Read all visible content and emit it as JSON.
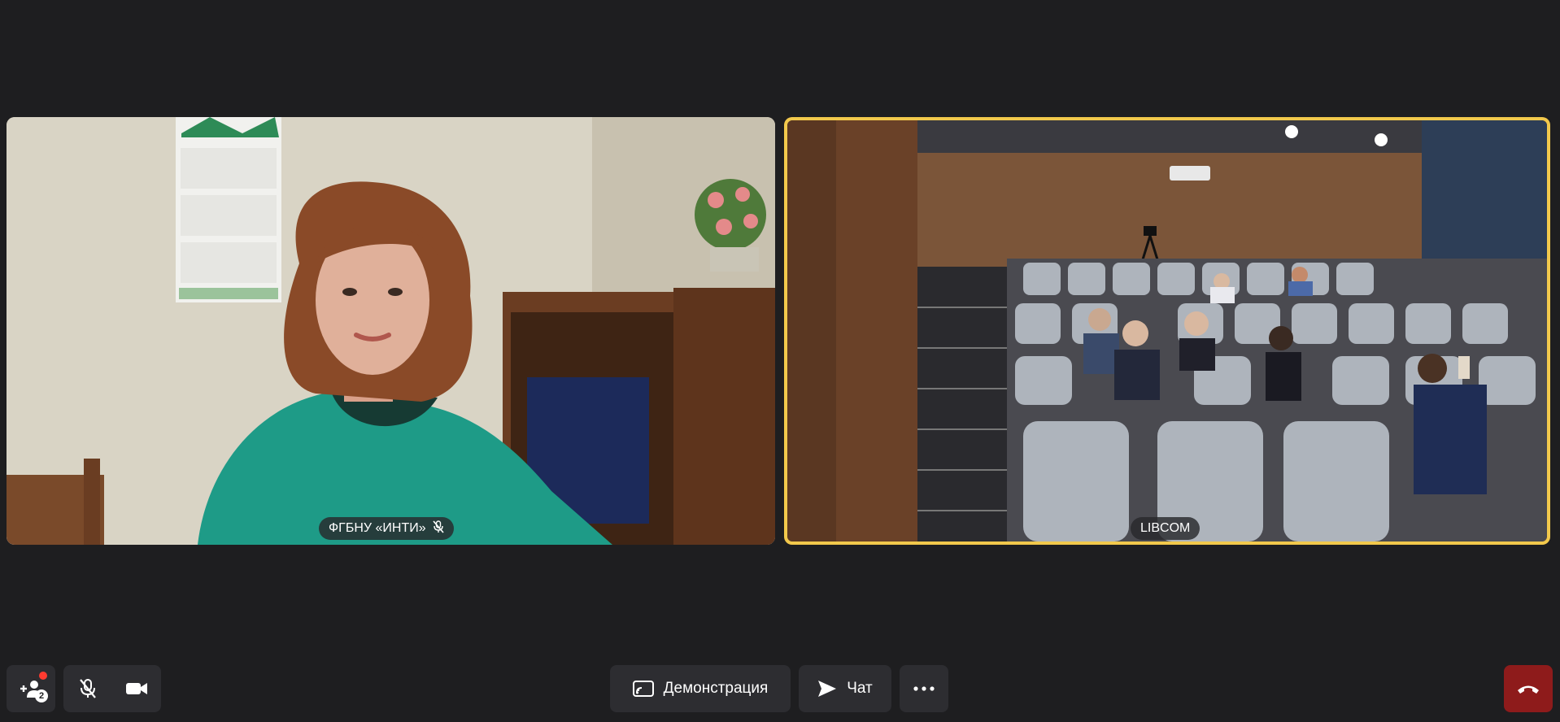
{
  "participants": [
    {
      "name": "ФГБНУ «ИНТИ»",
      "muted": true
    },
    {
      "name": "LIBCOM",
      "muted": false,
      "speaking": true
    }
  ],
  "toolbar": {
    "invite_count": "2",
    "screen_share_label": "Демонстрация",
    "chat_label": "Чат"
  },
  "colors": {
    "background": "#1e1e20",
    "button": "#2d2d31",
    "speaking_border": "#f2c94c",
    "end_call": "#8e1b1b",
    "notification": "#ff3b30"
  },
  "icons": {
    "invite": "person-add-icon",
    "mic": "mic-off-icon",
    "camera": "camera-icon",
    "screen_share": "screen-share-icon",
    "chat": "send-icon",
    "more": "more-icon",
    "end_call": "hang-up-icon"
  }
}
